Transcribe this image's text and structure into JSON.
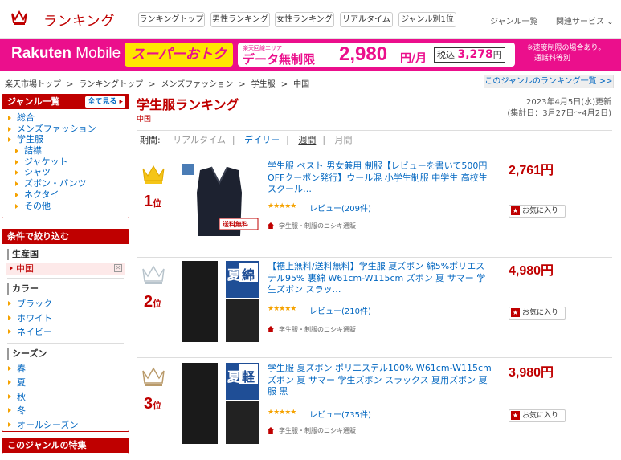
{
  "header": {
    "title": "ランキング",
    "tabs": [
      "ランキングトップ",
      "男性ランキング",
      "女性ランキング",
      "リアルタイム",
      "ジャンル別1位"
    ],
    "genre_list": "ジャンル一覧",
    "related": "関連サービス",
    "brand_color": "#bf0000"
  },
  "banner": {
    "brand": "Rakuten",
    "brand_suffix": "Mobile",
    "promo": "スーパーおトク",
    "area_note": "楽天回線エリア",
    "unlimited": "データ無制限",
    "price": "2,980",
    "price_unit": "円/月",
    "tax_label": "税込",
    "tax_price": "3,278",
    "tax_unit": "円",
    "note_line1": "※速度制限の場合あり。",
    "note_line2": "通話料等別",
    "color": "#eb0f8c"
  },
  "breadcrumb": [
    "楽天市場トップ",
    "ランキングトップ",
    "メンズファッション",
    "学生服",
    "中国"
  ],
  "genre_list_link": "このジャンルのランキング一覧 >>",
  "sidebar": {
    "genre_heading": "ジャンル一覧",
    "see_all": "全て見る",
    "genres": [
      {
        "label": "総合",
        "sub": false
      },
      {
        "label": "メンズファッション",
        "sub": false
      },
      {
        "label": "学生服",
        "sub": false
      },
      {
        "label": "詰襟",
        "sub": true
      },
      {
        "label": "ジャケット",
        "sub": true
      },
      {
        "label": "シャツ",
        "sub": true
      },
      {
        "label": "ズボン・パンツ",
        "sub": true
      },
      {
        "label": "ネクタイ",
        "sub": true
      },
      {
        "label": "その他",
        "sub": true
      }
    ],
    "filter_heading": "条件で絞り込む",
    "origin_heading": "生産国",
    "origin_selected": "中国",
    "color_heading": "カラー",
    "colors": [
      "ブラック",
      "ホワイト",
      "ネイビー"
    ],
    "season_heading": "シーズン",
    "seasons": [
      "春",
      "夏",
      "秋",
      "冬",
      "オールシーズン"
    ],
    "feature_heading": "このジャンルの特集"
  },
  "main": {
    "title": "学生服ランキング",
    "subtitle": "中国",
    "updated": "2023年4月5日(水)更新",
    "period_range": "(集計日：3月27日～4月2日)",
    "period_label": "期間:",
    "periods": [
      "リアルタイム",
      "デイリー",
      "週間",
      "月間"
    ],
    "period_selected": "週間"
  },
  "items": [
    {
      "rank": "1",
      "rank_suffix": "位",
      "crown_color": "#f5c518",
      "name": "学生服 ベスト 男女兼用 制服【レビューを書いて500円OFFクーポン発行】ウール混 小学生制服 中学生 高校生 スクール…",
      "reviews": "レビュー(209件)",
      "stars": "★★★★★",
      "shop": "学生服・制服のニシキ通販",
      "price": "2,761円",
      "favorite": "お気に入り",
      "badge": "送料無料"
    },
    {
      "rank": "2",
      "rank_suffix": "位",
      "crown_color": "#b8c4cc",
      "name": "【裾上無料/送料無料】学生服 夏ズボン 綿5%ポリエステル95% 裏綿 W61cm-W115cm ズボン 夏 サマー 学生ズボン スラッ…",
      "reviews": "レビュー(210件)",
      "stars": "★★★★★",
      "shop": "学生服・制服のニシキ通販",
      "price": "4,980円",
      "favorite": "お気に入り",
      "tag_main": "夏",
      "tag_sub": "綿"
    },
    {
      "rank": "3",
      "rank_suffix": "位",
      "crown_color": "#b99a6a",
      "name": "学生服 夏ズボン ポリエステル100% W61cm-W115cm ズボン 夏 サマー 学生ズボン スラックス 夏用ズボン 夏服 黒",
      "reviews": "レビュー(735件)",
      "stars": "★★★★★",
      "shop": "学生服・制服のニシキ通販",
      "price": "3,980円",
      "favorite": "お気に入り",
      "tag_main": "夏",
      "tag_sub": "軽"
    }
  ]
}
